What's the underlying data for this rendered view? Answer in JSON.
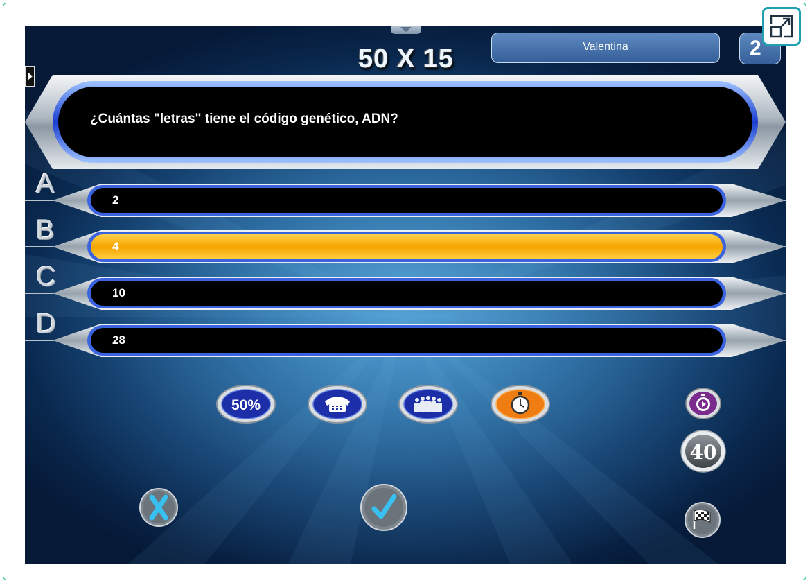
{
  "game": {
    "title": "50 X 15",
    "player_name": "Valentina",
    "score": "2"
  },
  "question": {
    "text": "¿Cuántas \"letras\" tiene el código genético, ADN?"
  },
  "answers": [
    {
      "letter": "A",
      "text": "2",
      "selected": false
    },
    {
      "letter": "B",
      "text": "4",
      "selected": true
    },
    {
      "letter": "C",
      "text": "10",
      "selected": false
    },
    {
      "letter": "D",
      "text": "28",
      "selected": false
    }
  ],
  "lifelines": {
    "fifty_label": "50%",
    "phone_icon": "telephone-icon",
    "audience_icon": "audience-icon",
    "timer_icon": "stopwatch-icon"
  },
  "timer": {
    "seconds": "40"
  },
  "controls": {
    "cancel_icon": "x-icon",
    "confirm_icon": "check-icon",
    "finish_icon": "checkered-flag-icon"
  },
  "colors": {
    "selected_answer": "#f7a400",
    "answer_bar": "#000000",
    "timer_lifeline_active": "#f07d12",
    "lifeline_blue": "#1d2fa8"
  }
}
